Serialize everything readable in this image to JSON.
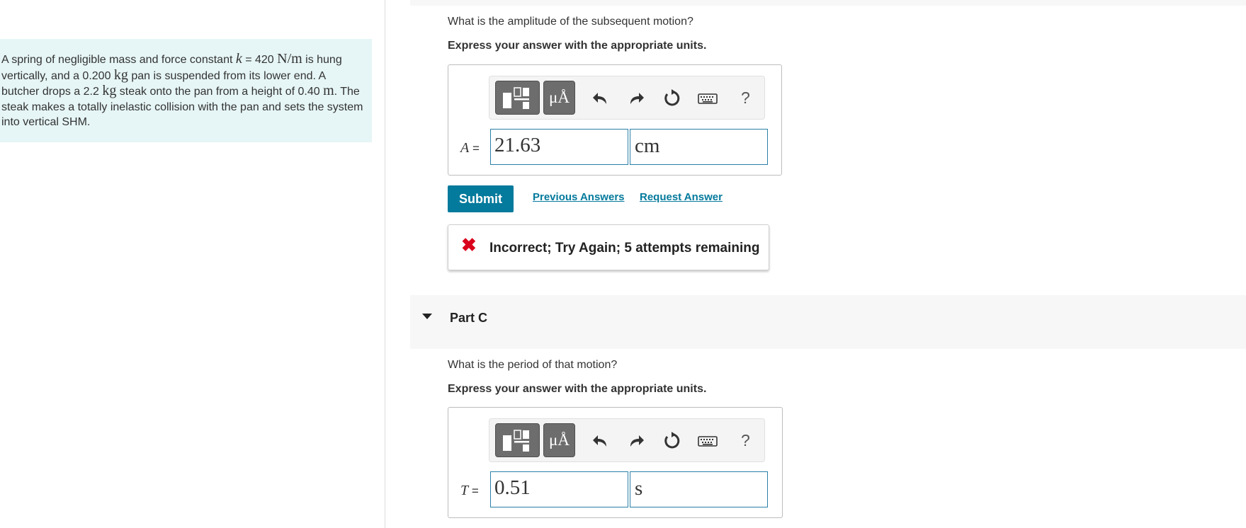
{
  "problem": {
    "t1": "A spring of negligible mass and force constant ",
    "k_sym": "k",
    "t2": " = 420 ",
    "u1": "N/m",
    "t3": " is hung vertically, and a 0.200 ",
    "u2": "kg",
    "t4": " pan is suspended from its lower end. A butcher drops a 2.2 ",
    "u3": "kg",
    "t5": " steak onto the pan from a height of 0.40 ",
    "u4": "m",
    "t6": ". The steak makes a totally inelastic collision with the pan and sets the system into vertical SHM."
  },
  "partB": {
    "question": "What is the amplitude of the subsequent motion?",
    "instruction": "Express your answer with the appropriate units.",
    "var_symbol": "A",
    "equals": "=",
    "value": "21.63",
    "unit": "cm",
    "submit_label": "Submit",
    "previous_answers": "Previous Answers",
    "request_answer": "Request Answer",
    "feedback_icon": "✖",
    "feedback_text": "Incorrect; Try Again; 5 attempts remaining"
  },
  "partC": {
    "title": "Part C",
    "question": "What is the period of that motion?",
    "instruction": "Express your answer with the appropriate units.",
    "var_symbol": "T",
    "equals": "=",
    "value": "0.51",
    "unit": "s"
  },
  "toolbar": {
    "units_label": "μÅ",
    "help_label": "?"
  },
  "colors": {
    "accent": "#047a9c",
    "problem_bg": "#e6f5f5",
    "error": "#d9001b"
  }
}
